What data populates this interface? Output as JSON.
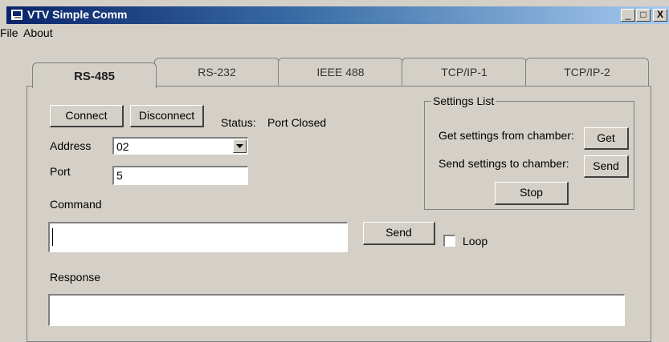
{
  "window": {
    "title": "VTV Simple Comm",
    "controls": {
      "minimize": "_",
      "maximize": "□",
      "close": "X"
    }
  },
  "menu": {
    "items": [
      "File",
      "About"
    ]
  },
  "tabs": [
    {
      "label": "RS-485",
      "active": true
    },
    {
      "label": "RS-232",
      "active": false
    },
    {
      "label": "IEEE 488",
      "active": false
    },
    {
      "label": "TCP/IP-1",
      "active": false
    },
    {
      "label": "TCP/IP-2",
      "active": false
    }
  ],
  "connection": {
    "connect_label": "Connect",
    "disconnect_label": "Disconnect",
    "status_label": "Status:",
    "status_value": "Port Closed"
  },
  "address": {
    "label": "Address",
    "value": "02"
  },
  "port": {
    "label": "Port",
    "value": "5"
  },
  "command": {
    "label": "Command",
    "value": "",
    "send_label": "Send",
    "loop_label": "Loop",
    "loop_checked": false
  },
  "response": {
    "label": "Response",
    "value": ""
  },
  "settings": {
    "title": "Settings List",
    "get_text": "Get settings from chamber:",
    "get_label": "Get",
    "send_text": "Send settings to chamber:",
    "send_label": "Send",
    "stop_label": "Stop"
  },
  "colors": {
    "face": "#d4d0c8",
    "title_start": "#0a246a",
    "title_end": "#a6caf0"
  }
}
